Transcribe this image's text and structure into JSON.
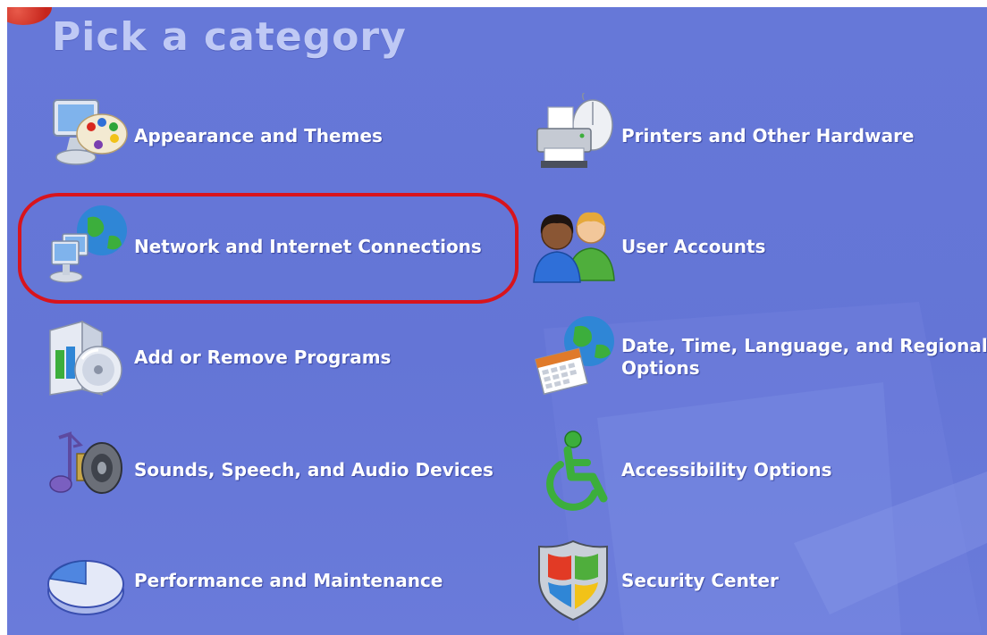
{
  "title": "Pick a category",
  "categories": [
    {
      "label": "Appearance and Themes",
      "icon": "appearance-themes-icon"
    },
    {
      "label": "Printers and Other Hardware",
      "icon": "printer-hardware-icon"
    },
    {
      "label": "Network and Internet Connections",
      "icon": "network-internet-icon"
    },
    {
      "label": "User Accounts",
      "icon": "user-accounts-icon"
    },
    {
      "label": "Add or Remove Programs",
      "icon": "add-remove-programs-icon"
    },
    {
      "label": "Date, Time, Language, and Regional Options",
      "icon": "date-time-language-icon"
    },
    {
      "label": "Sounds, Speech, and Audio Devices",
      "icon": "sounds-audio-icon"
    },
    {
      "label": "Accessibility Options",
      "icon": "accessibility-icon"
    },
    {
      "label": "Performance and Maintenance",
      "icon": "performance-maintenance-icon"
    },
    {
      "label": "Security Center",
      "icon": "security-center-icon"
    }
  ],
  "highlighted_category": "Network and Internet Connections",
  "colors": {
    "background": "#6475d6",
    "title": "#bfc9f5",
    "label": "#ffffff",
    "highlight_ring": "#d8141c"
  }
}
